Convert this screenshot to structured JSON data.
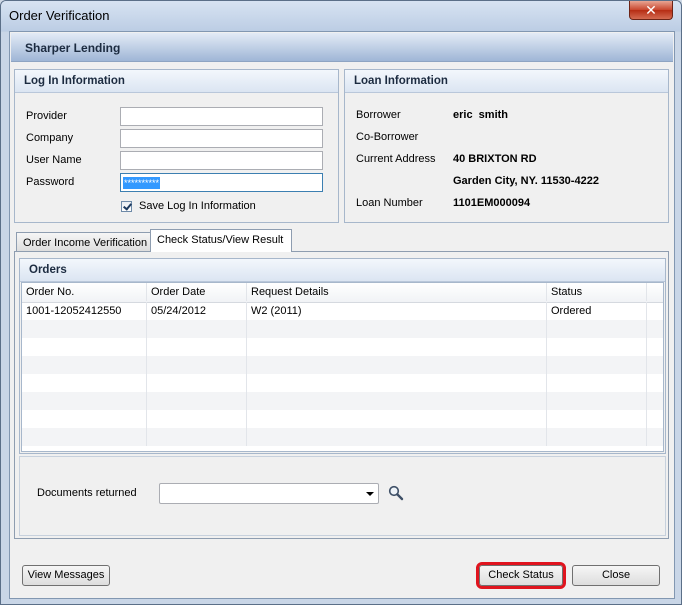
{
  "window": {
    "title": "Order Verification",
    "close_glyph": "✕"
  },
  "brand": "Sharper Lending",
  "login": {
    "heading": "Log In Information",
    "provider_label": "Provider",
    "provider_value": "",
    "company_label": "Company",
    "company_value": "",
    "username_label": "User Name",
    "username_value": "",
    "password_label": "Password",
    "password_value": "**********",
    "save_label": "Save Log In Information",
    "save_checked": true
  },
  "loan": {
    "heading": "Loan Information",
    "borrower_label": "Borrower",
    "borrower_value": "eric  smith",
    "coborrower_label": "Co-Borrower",
    "coborrower_value": "",
    "address_label": "Current Address",
    "address_line1": "40 BRIXTON RD",
    "address_line2": "Garden City, NY. 11530-4222",
    "loan_number_label": "Loan Number",
    "loan_number_value": "1101EM000094"
  },
  "tabs": [
    {
      "label": "Order Income Verification",
      "active": false
    },
    {
      "label": "Check Status/View Result",
      "active": true
    }
  ],
  "orders": {
    "heading": "Orders",
    "columns": [
      "Order No.",
      "Order Date",
      "Request Details",
      "Status"
    ],
    "rows": [
      [
        "1001-12052412550",
        "05/24/2012",
        "W2 (2011)",
        "Ordered"
      ]
    ]
  },
  "documents": {
    "label": "Documents returned",
    "selected": "",
    "icon": "magnifier-icon"
  },
  "buttons": {
    "view_messages": "View Messages",
    "check_status": "Check Status",
    "close": "Close"
  },
  "colors": {
    "highlight": "#e0141e",
    "selection": "#3399ff"
  }
}
